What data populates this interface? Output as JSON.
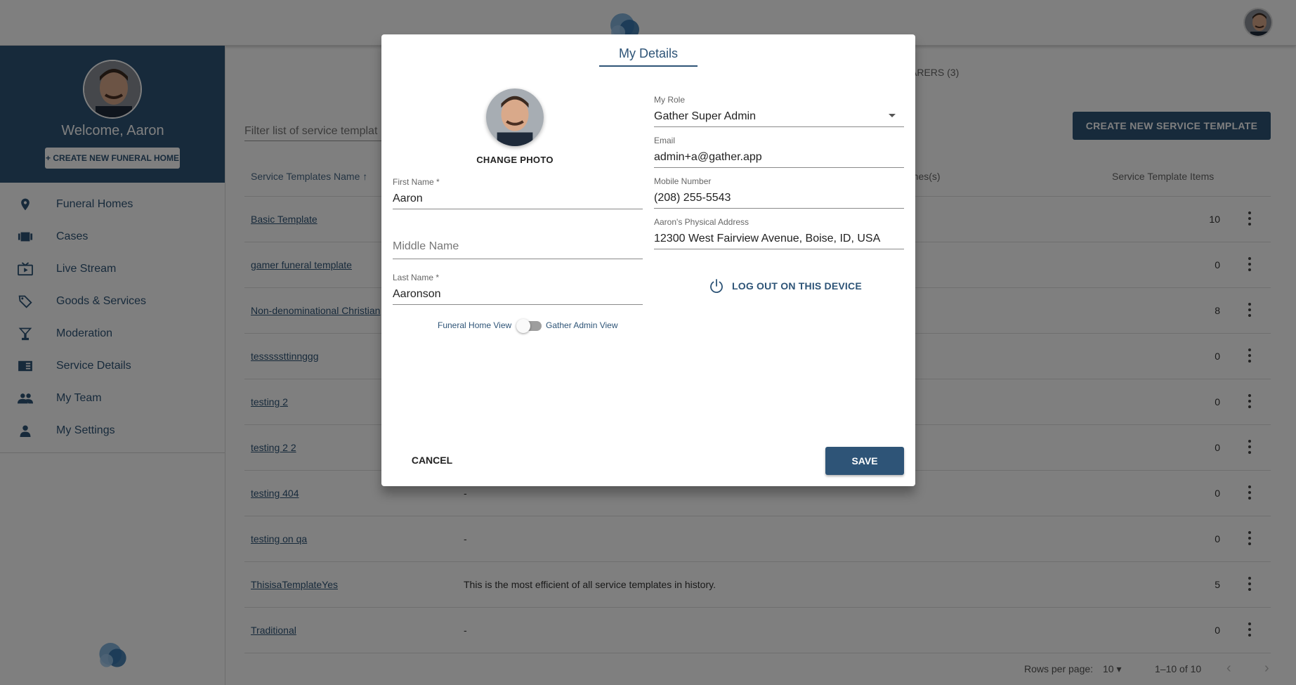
{
  "colors": {
    "primary": "#2e5477",
    "overlay": "rgba(0,0,0,0.5)"
  },
  "sidebar": {
    "welcome": "Welcome, Aaron",
    "create_button": "+ CREATE NEW FUNERAL HOME",
    "items": [
      {
        "label": "Funeral Homes",
        "icon": "location-pin-icon"
      },
      {
        "label": "Cases",
        "icon": "cases-icon"
      },
      {
        "label": "Live Stream",
        "icon": "live-tv-icon"
      },
      {
        "label": "Goods & Services",
        "icon": "tag-icon"
      },
      {
        "label": "Moderation",
        "icon": "moderation-icon"
      },
      {
        "label": "Service Details",
        "icon": "service-details-icon"
      },
      {
        "label": "My Team",
        "icon": "people-icon"
      },
      {
        "label": "My Settings",
        "icon": "person-icon"
      }
    ]
  },
  "main": {
    "tab_partial": "ARERS (3)",
    "filter_placeholder": "Filter list of service templat",
    "create_button": "CREATE NEW SERVICE TEMPLATE",
    "table": {
      "col_name": "Service Templates Name",
      "col_homes": "omes(s)",
      "col_items": "Service Template Items",
      "rows": [
        {
          "name": "Basic Template",
          "desc": "",
          "count": "10"
        },
        {
          "name": "gamer funeral template",
          "desc": "",
          "count": "0"
        },
        {
          "name": "Non-denominational Christian",
          "desc": "",
          "count": "8"
        },
        {
          "name": "tesssssttinnggg",
          "desc": "",
          "count": "0"
        },
        {
          "name": "testing 2",
          "desc": "",
          "count": "0"
        },
        {
          "name": "testing 2 2",
          "desc": "",
          "count": "0"
        },
        {
          "name": "testing 404",
          "desc": "-",
          "count": "0"
        },
        {
          "name": "testing on qa",
          "desc": "-",
          "count": "0"
        },
        {
          "name": "ThisisaTemplateYes",
          "desc": "This is the most efficient of all service templates in history.",
          "count": "5"
        },
        {
          "name": "Traditional",
          "desc": "-",
          "count": "0"
        }
      ]
    },
    "pager": {
      "rows_per_page_label": "Rows per page:",
      "rows_per_page": "10",
      "range": "1–10 of 10"
    }
  },
  "dialog": {
    "title": "My Details",
    "change_photo": "CHANGE PHOTO",
    "first_name": {
      "label": "First Name *",
      "value": "Aaron"
    },
    "middle_name": {
      "placeholder": "Middle Name"
    },
    "last_name": {
      "label": "Last Name *",
      "value": "Aaronson"
    },
    "role": {
      "label": "My Role",
      "value": "Gather Super Admin"
    },
    "email": {
      "label": "Email",
      "value": "admin+a@gather.app"
    },
    "mobile": {
      "label": "Mobile Number",
      "value": "(208) 255-5543"
    },
    "address": {
      "label": "Aaron's Physical Address",
      "value": "12300 West Fairview Avenue, Boise, ID, USA"
    },
    "logout": "LOG OUT ON THIS DEVICE",
    "toggle": {
      "left_label": "Funeral Home View",
      "right_label": "Gather Admin View",
      "on": false
    },
    "cancel": "CANCEL",
    "save": "SAVE"
  }
}
